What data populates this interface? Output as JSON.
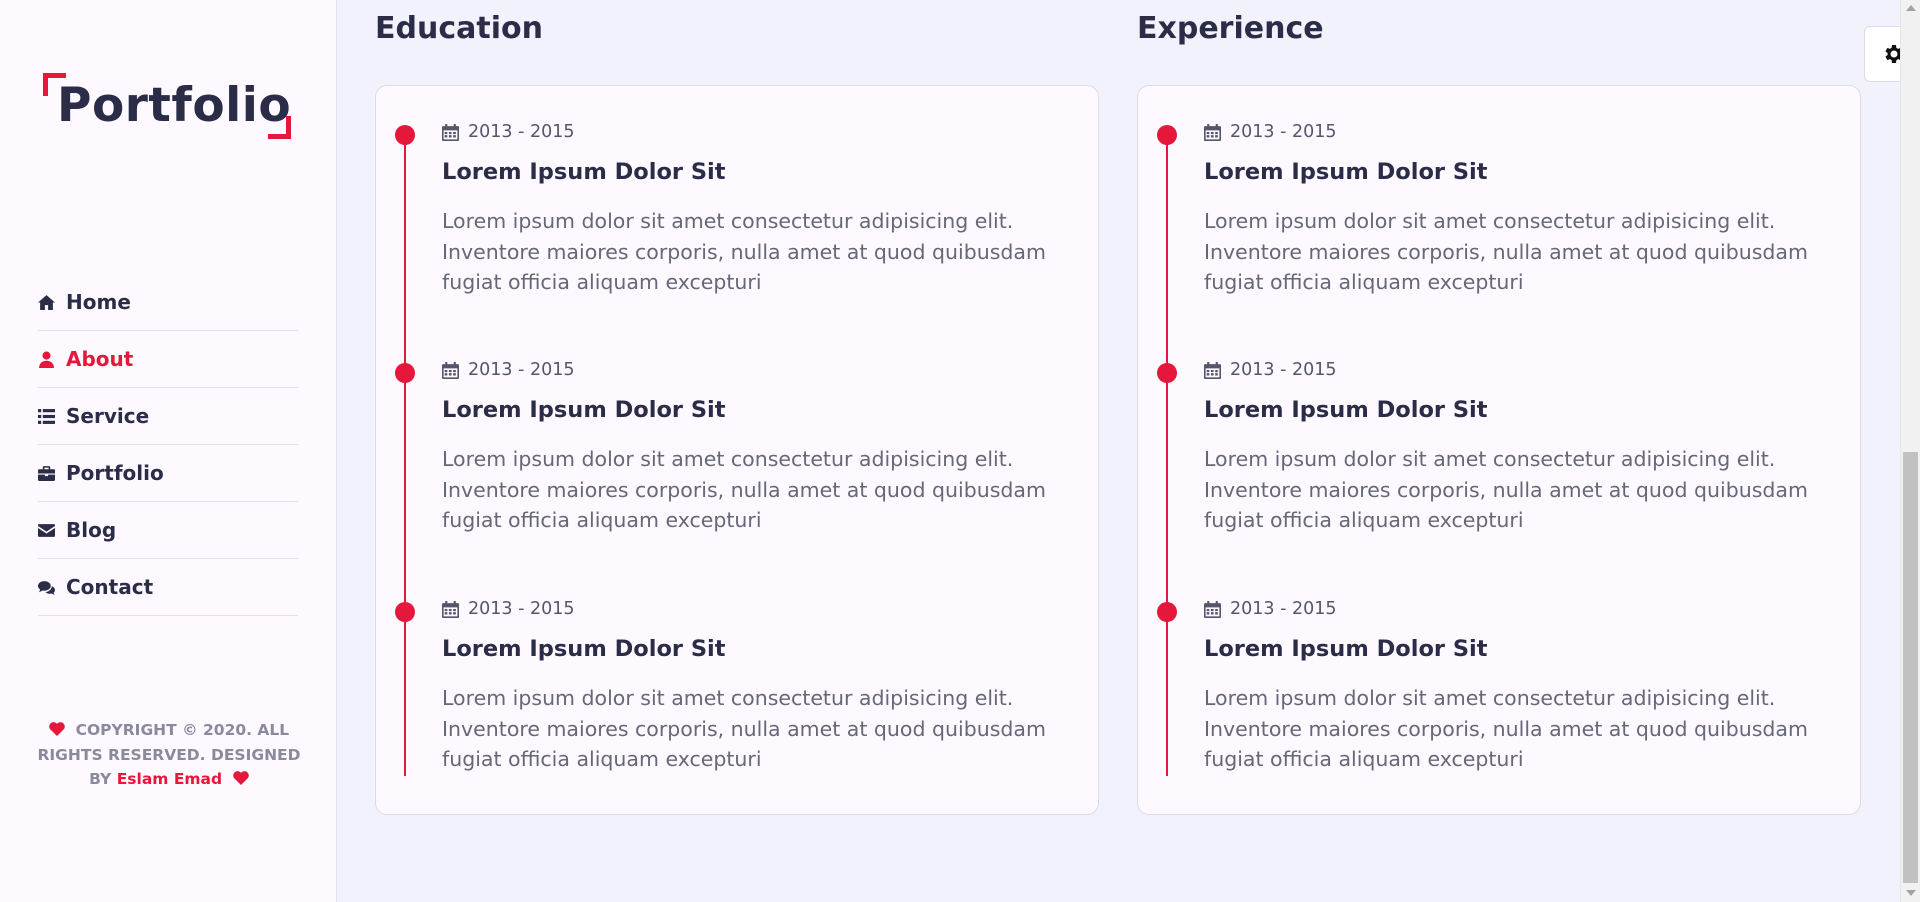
{
  "colors": {
    "accent": "#e5183b",
    "text_dark": "#2b2c48",
    "sidebar_bg": "#fdf9ff",
    "page_bg": "#f1f2fb"
  },
  "sidebar": {
    "logo_text": "Portfolio",
    "nav": [
      {
        "label": "Home",
        "icon": "home-icon",
        "active": false
      },
      {
        "label": "About",
        "icon": "user-icon",
        "active": true
      },
      {
        "label": "Service",
        "icon": "list-icon",
        "active": false
      },
      {
        "label": "Portfolio",
        "icon": "briefcase-icon",
        "active": false
      },
      {
        "label": "Blog",
        "icon": "envelope-icon",
        "active": false
      },
      {
        "label": "Contact",
        "icon": "comments-icon",
        "active": false
      }
    ],
    "copyright": {
      "text": "COPYRIGHT © 2020. ALL RIGHTS RESERVED. DESIGNED BY",
      "author": "Eslam Emad"
    }
  },
  "sections": [
    {
      "title": "Education",
      "entries": [
        {
          "date": "2013 - 2015",
          "title": "Lorem Ipsum Dolor Sit",
          "description": "Lorem ipsum dolor sit amet consectetur adipisicing elit. Inventore maiores corporis, nulla amet at quod quibusdam fugiat officia aliquam excepturi"
        },
        {
          "date": "2013 - 2015",
          "title": "Lorem Ipsum Dolor Sit",
          "description": "Lorem ipsum dolor sit amet consectetur adipisicing elit. Inventore maiores corporis, nulla amet at quod quibusdam fugiat officia aliquam excepturi"
        },
        {
          "date": "2013 - 2015",
          "title": "Lorem Ipsum Dolor Sit",
          "description": "Lorem ipsum dolor sit amet consectetur adipisicing elit. Inventore maiores corporis, nulla amet at quod quibusdam fugiat officia aliquam excepturi"
        }
      ]
    },
    {
      "title": "Experience",
      "entries": [
        {
          "date": "2013 - 2015",
          "title": "Lorem Ipsum Dolor Sit",
          "description": "Lorem ipsum dolor sit amet consectetur adipisicing elit. Inventore maiores corporis, nulla amet at quod quibusdam fugiat officia aliquam excepturi"
        },
        {
          "date": "2013 - 2015",
          "title": "Lorem Ipsum Dolor Sit",
          "description": "Lorem ipsum dolor sit amet consectetur adipisicing elit. Inventore maiores corporis, nulla amet at quod quibusdam fugiat officia aliquam excepturi"
        },
        {
          "date": "2013 - 2015",
          "title": "Lorem Ipsum Dolor Sit",
          "description": "Lorem ipsum dolor sit amet consectetur adipisicing elit. Inventore maiores corporis, nulla amet at quod quibusdam fugiat officia aliquam excepturi"
        }
      ]
    }
  ],
  "settings": {
    "icon": "gear-icon"
  }
}
